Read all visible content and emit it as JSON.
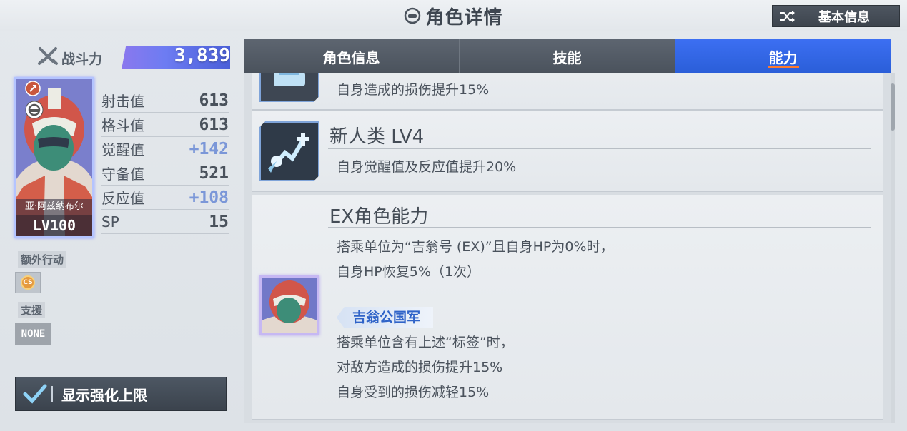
{
  "header": {
    "title": "角色详情",
    "basic_info_label": "基本信息"
  },
  "character": {
    "power_label": "战斗力",
    "power_value": "3,839",
    "name": "亚·阿兹纳布尔",
    "level": "LV100",
    "stats": [
      {
        "name": "射击值",
        "value": "613",
        "bonus": false
      },
      {
        "name": "格斗值",
        "value": "613",
        "bonus": false
      },
      {
        "name": "觉醒值",
        "value": "+142",
        "bonus": true
      },
      {
        "name": "守备值",
        "value": "521",
        "bonus": false
      },
      {
        "name": "反应值",
        "value": "+108",
        "bonus": true
      },
      {
        "name": "SP",
        "value": "15",
        "bonus": false
      }
    ],
    "extra_action_label": "额外行动",
    "extra_action_chip": "CS",
    "support_label": "支援",
    "support_value": "NONE",
    "show_limit_label": "显示强化上限"
  },
  "tabs": [
    {
      "label": "角色信息",
      "active": false
    },
    {
      "label": "技能",
      "active": false
    },
    {
      "label": "能力",
      "active": true
    }
  ],
  "abilities": [
    {
      "name": "",
      "desc": [
        "自身造成的损伤提升15%"
      ]
    },
    {
      "name": "新人类 LV4",
      "desc": [
        "自身觉醒值及反应值提升20%"
      ]
    },
    {
      "name": "EX角色能力",
      "desc": [
        "搭乘单位为“吉翁号 (EX)”且自身HP为0%时，",
        "自身HP恢复5%（1次）"
      ],
      "tag": "吉翁公国军",
      "tag_desc": [
        "搭乘单位含有上述“标签”时，",
        "对敌方造成的损伤提升15%",
        "自身受到的损伤减轻15%"
      ]
    }
  ],
  "colors": {
    "accent_blue": "#2a5ed8",
    "bonus_stat": "#7b97d8",
    "tab_underline": "#ff7a2d",
    "tag_text": "#2f63c8"
  },
  "icons": {
    "title": "helmet-icon",
    "basic_info": "shuffle-icon",
    "power": "crossed-swords-icon",
    "limit": "check-icon",
    "newtype": "newtype-ability-icon"
  }
}
